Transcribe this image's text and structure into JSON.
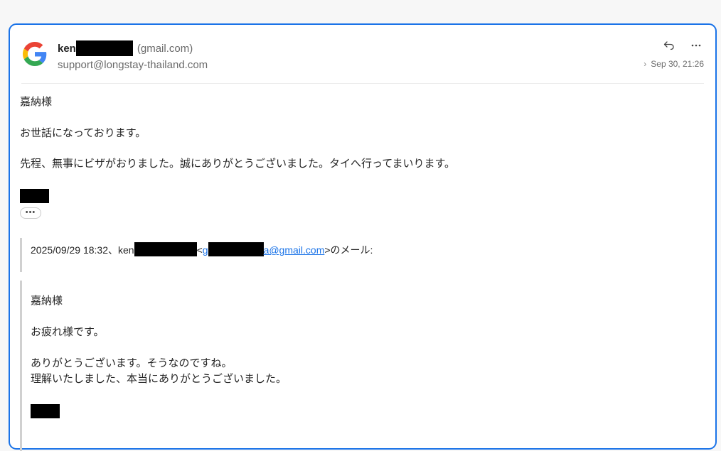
{
  "sender": {
    "name_visible": "ken",
    "domain": "(gmail.com)"
  },
  "recipient": "support@longstay-thailand.com",
  "date": "Sep 30, 21:26",
  "icons": {
    "logo": "google-logo-icon",
    "reply": "reply-icon",
    "more": "more-icon",
    "expand_chevron": "chevron-right-icon",
    "trimmed_content": "ellipsis-icon"
  },
  "colors": {
    "accent": "#1a73e8",
    "quote_bar": "#d0d0d0"
  },
  "body": {
    "greeting": "嘉納様",
    "line1": "お世話になっております。",
    "line2": "先程、無事にビザがおりました。誠にありがとうございました。タイへ行ってまいります。"
  },
  "quote": {
    "date_text": "2025/09/29 18:32、ken",
    "email_prefix": "g",
    "email_suffix": "a@gmail.com",
    "suffix_text": "のメール:",
    "greeting": "嘉納様",
    "line1": "お疲れ様です。",
    "line2": "ありがとうございます。そうなのですね。",
    "line3": "理解いたしました、本当にありがとうございました。"
  },
  "expand_label": "•••"
}
